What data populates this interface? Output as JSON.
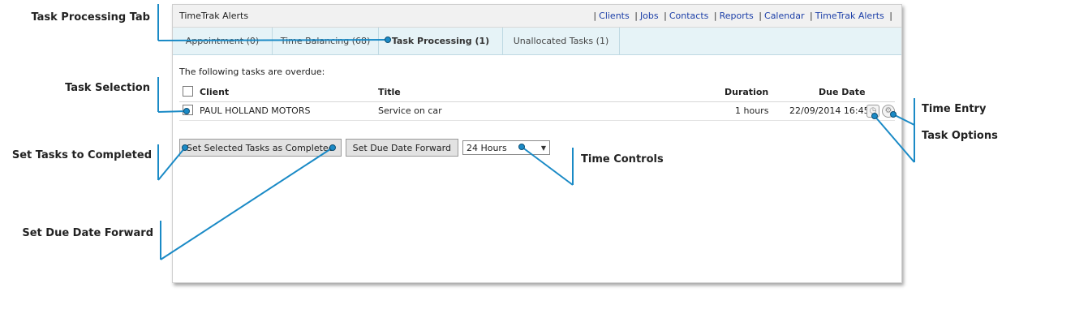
{
  "app": {
    "title": "TimeTrak Alerts"
  },
  "nav": [
    {
      "label": "Clients"
    },
    {
      "label": "Jobs"
    },
    {
      "label": "Contacts"
    },
    {
      "label": "Reports"
    },
    {
      "label": "Calendar"
    },
    {
      "label": "TimeTrak Alerts"
    }
  ],
  "tabs": [
    {
      "label": "Appointment (0)",
      "active": false
    },
    {
      "label": "Time Balancing (68)",
      "active": false
    },
    {
      "label": "Task Processing (1)",
      "active": true
    },
    {
      "label": "Unallocated Tasks (1)",
      "active": false
    }
  ],
  "content": {
    "overdue_text": "The following tasks are overdue:",
    "columns": {
      "client": "Client",
      "title": "Title",
      "duration": "Duration",
      "due_date": "Due Date"
    },
    "rows": [
      {
        "client": "PAUL HOLLAND MOTORS",
        "title": "Service on car",
        "duration": "1 hours",
        "due_date": "22/09/2014 16:45"
      }
    ]
  },
  "actions": {
    "complete_label": "Set Selected Tasks as Completed",
    "forward_label": "Set Due Date Forward",
    "interval_value": "24 Hours"
  },
  "callouts": {
    "task_processing_tab": "Task Processing Tab",
    "task_selection": "Task Selection",
    "set_completed": "Set Tasks to Completed",
    "set_due_forward": "Set Due Date Forward",
    "time_controls": "Time Controls",
    "time_entry": "Time Entry",
    "task_options": "Task Options"
  },
  "colors": {
    "accent": "#1a8ac6",
    "tab_bg": "#e6f3f7",
    "link": "#1c3fa8"
  }
}
